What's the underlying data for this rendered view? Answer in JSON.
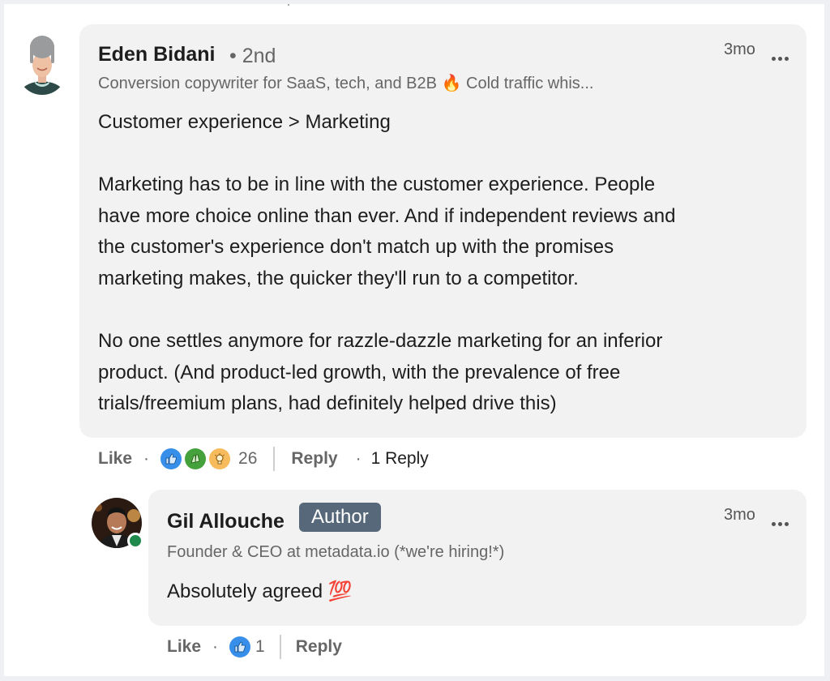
{
  "comment": {
    "author": {
      "name": "Eden Bidani",
      "degree": "• 2nd",
      "headline": "Conversion copywriter for SaaS, tech, and B2B 🔥 Cold traffic whis...",
      "avatar": "avatar-eden-bidani"
    },
    "time": "3mo",
    "more_icon": "more-horizontal-icon",
    "paragraphs": [
      "Customer experience > Marketing",
      "Marketing has to be in line with the customer experience. People\nhave more choice online than ever. And if independent reviews and\nthe customer's experience don't match up with the promises\nmarketing makes, the quicker they'll run to a competitor.",
      "No one settles anymore for razzle-dazzle marketing for an inferior\nproduct. (And product-led growth, with the prevalence of free\ntrials/freemium plans, had definitely helped drive this)"
    ],
    "actions": {
      "like_label": "Like",
      "separator": "·",
      "reactions": [
        "like-icon",
        "celebrate-icon",
        "insightful-icon"
      ],
      "reaction_count": "26",
      "reply_label": "Reply",
      "replies_label": "1 Reply"
    }
  },
  "reply": {
    "author": {
      "name": "Gil Allouche",
      "badge": "Author",
      "headline": "Founder & CEO at metadata.io (*we're hiring!*)",
      "avatar": "avatar-gil-allouche",
      "online": true
    },
    "time": "3mo",
    "more_icon": "more-horizontal-icon",
    "text": "Absolutely agreed 💯",
    "actions": {
      "like_label": "Like",
      "separator": "·",
      "reactions": [
        "like-icon"
      ],
      "reaction_count": "1",
      "reply_label": "Reply"
    }
  },
  "colors": {
    "badge_bg": "#56687a",
    "online_dot": "#1f8a4c",
    "like_blue": "#378fe9",
    "celebrate_green": "#44a13b",
    "insightful_orange": "#f5bb5c",
    "bubble_bg": "#f2f2f2"
  }
}
